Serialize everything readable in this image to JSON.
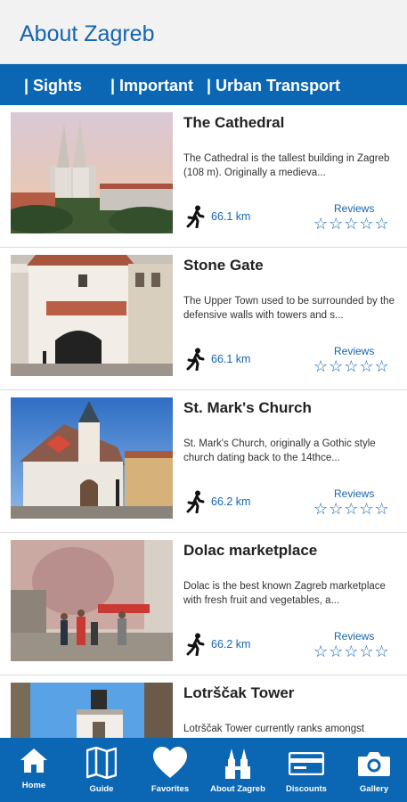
{
  "header": {
    "title": "About Zagreb"
  },
  "tabs": [
    {
      "label": "| Sights"
    },
    {
      "label": "| Important"
    },
    {
      "label": "| Urban Transport"
    }
  ],
  "places": [
    {
      "title": "The Cathedral",
      "description": "The Cathedral is the tallest building in Zagreb (108 m). Originally a medieva...",
      "distance": "66.1 km",
      "reviews_label": "Reviews",
      "stars": "☆☆☆☆☆",
      "rating": 0
    },
    {
      "title": "Stone Gate",
      "description": "The Upper Town used to be surrounded by the defensive walls with towers and s...",
      "distance": "66.1 km",
      "reviews_label": "Reviews",
      "stars": "☆☆☆☆☆",
      "rating": 0
    },
    {
      "title": "St. Mark's Church",
      "description": "St. Mark's Church, originally a Gothic style church dating back to the 14thce...",
      "distance": "66.2 km",
      "reviews_label": "Reviews",
      "stars": "☆☆☆☆☆",
      "rating": 0
    },
    {
      "title": "Dolac marketplace",
      "description": "Dolac is the best known Zagreb marketplace with fresh fruit and vegetables, a...",
      "distance": "66.2 km",
      "reviews_label": "Reviews",
      "stars": "☆☆☆☆☆",
      "rating": 0
    },
    {
      "title": "Lotrščak Tower",
      "description": "Lotrščak Tower currently ranks amongst",
      "distance": "",
      "reviews_label": "",
      "stars": "",
      "rating": 0
    }
  ],
  "bottom_nav": [
    {
      "label": "Home",
      "icon": "home-icon"
    },
    {
      "label": "Guide",
      "icon": "map-icon"
    },
    {
      "label": "Favorites",
      "icon": "heart-icon"
    },
    {
      "label": "About Zagreb",
      "icon": "cathedral-icon"
    },
    {
      "label": "Discounts",
      "icon": "card-icon"
    },
    {
      "label": "Gallery",
      "icon": "camera-icon"
    }
  ],
  "colors": {
    "primary": "#0b66b4",
    "accent_text": "#1565b0",
    "header_bg": "#f2f2f2"
  }
}
